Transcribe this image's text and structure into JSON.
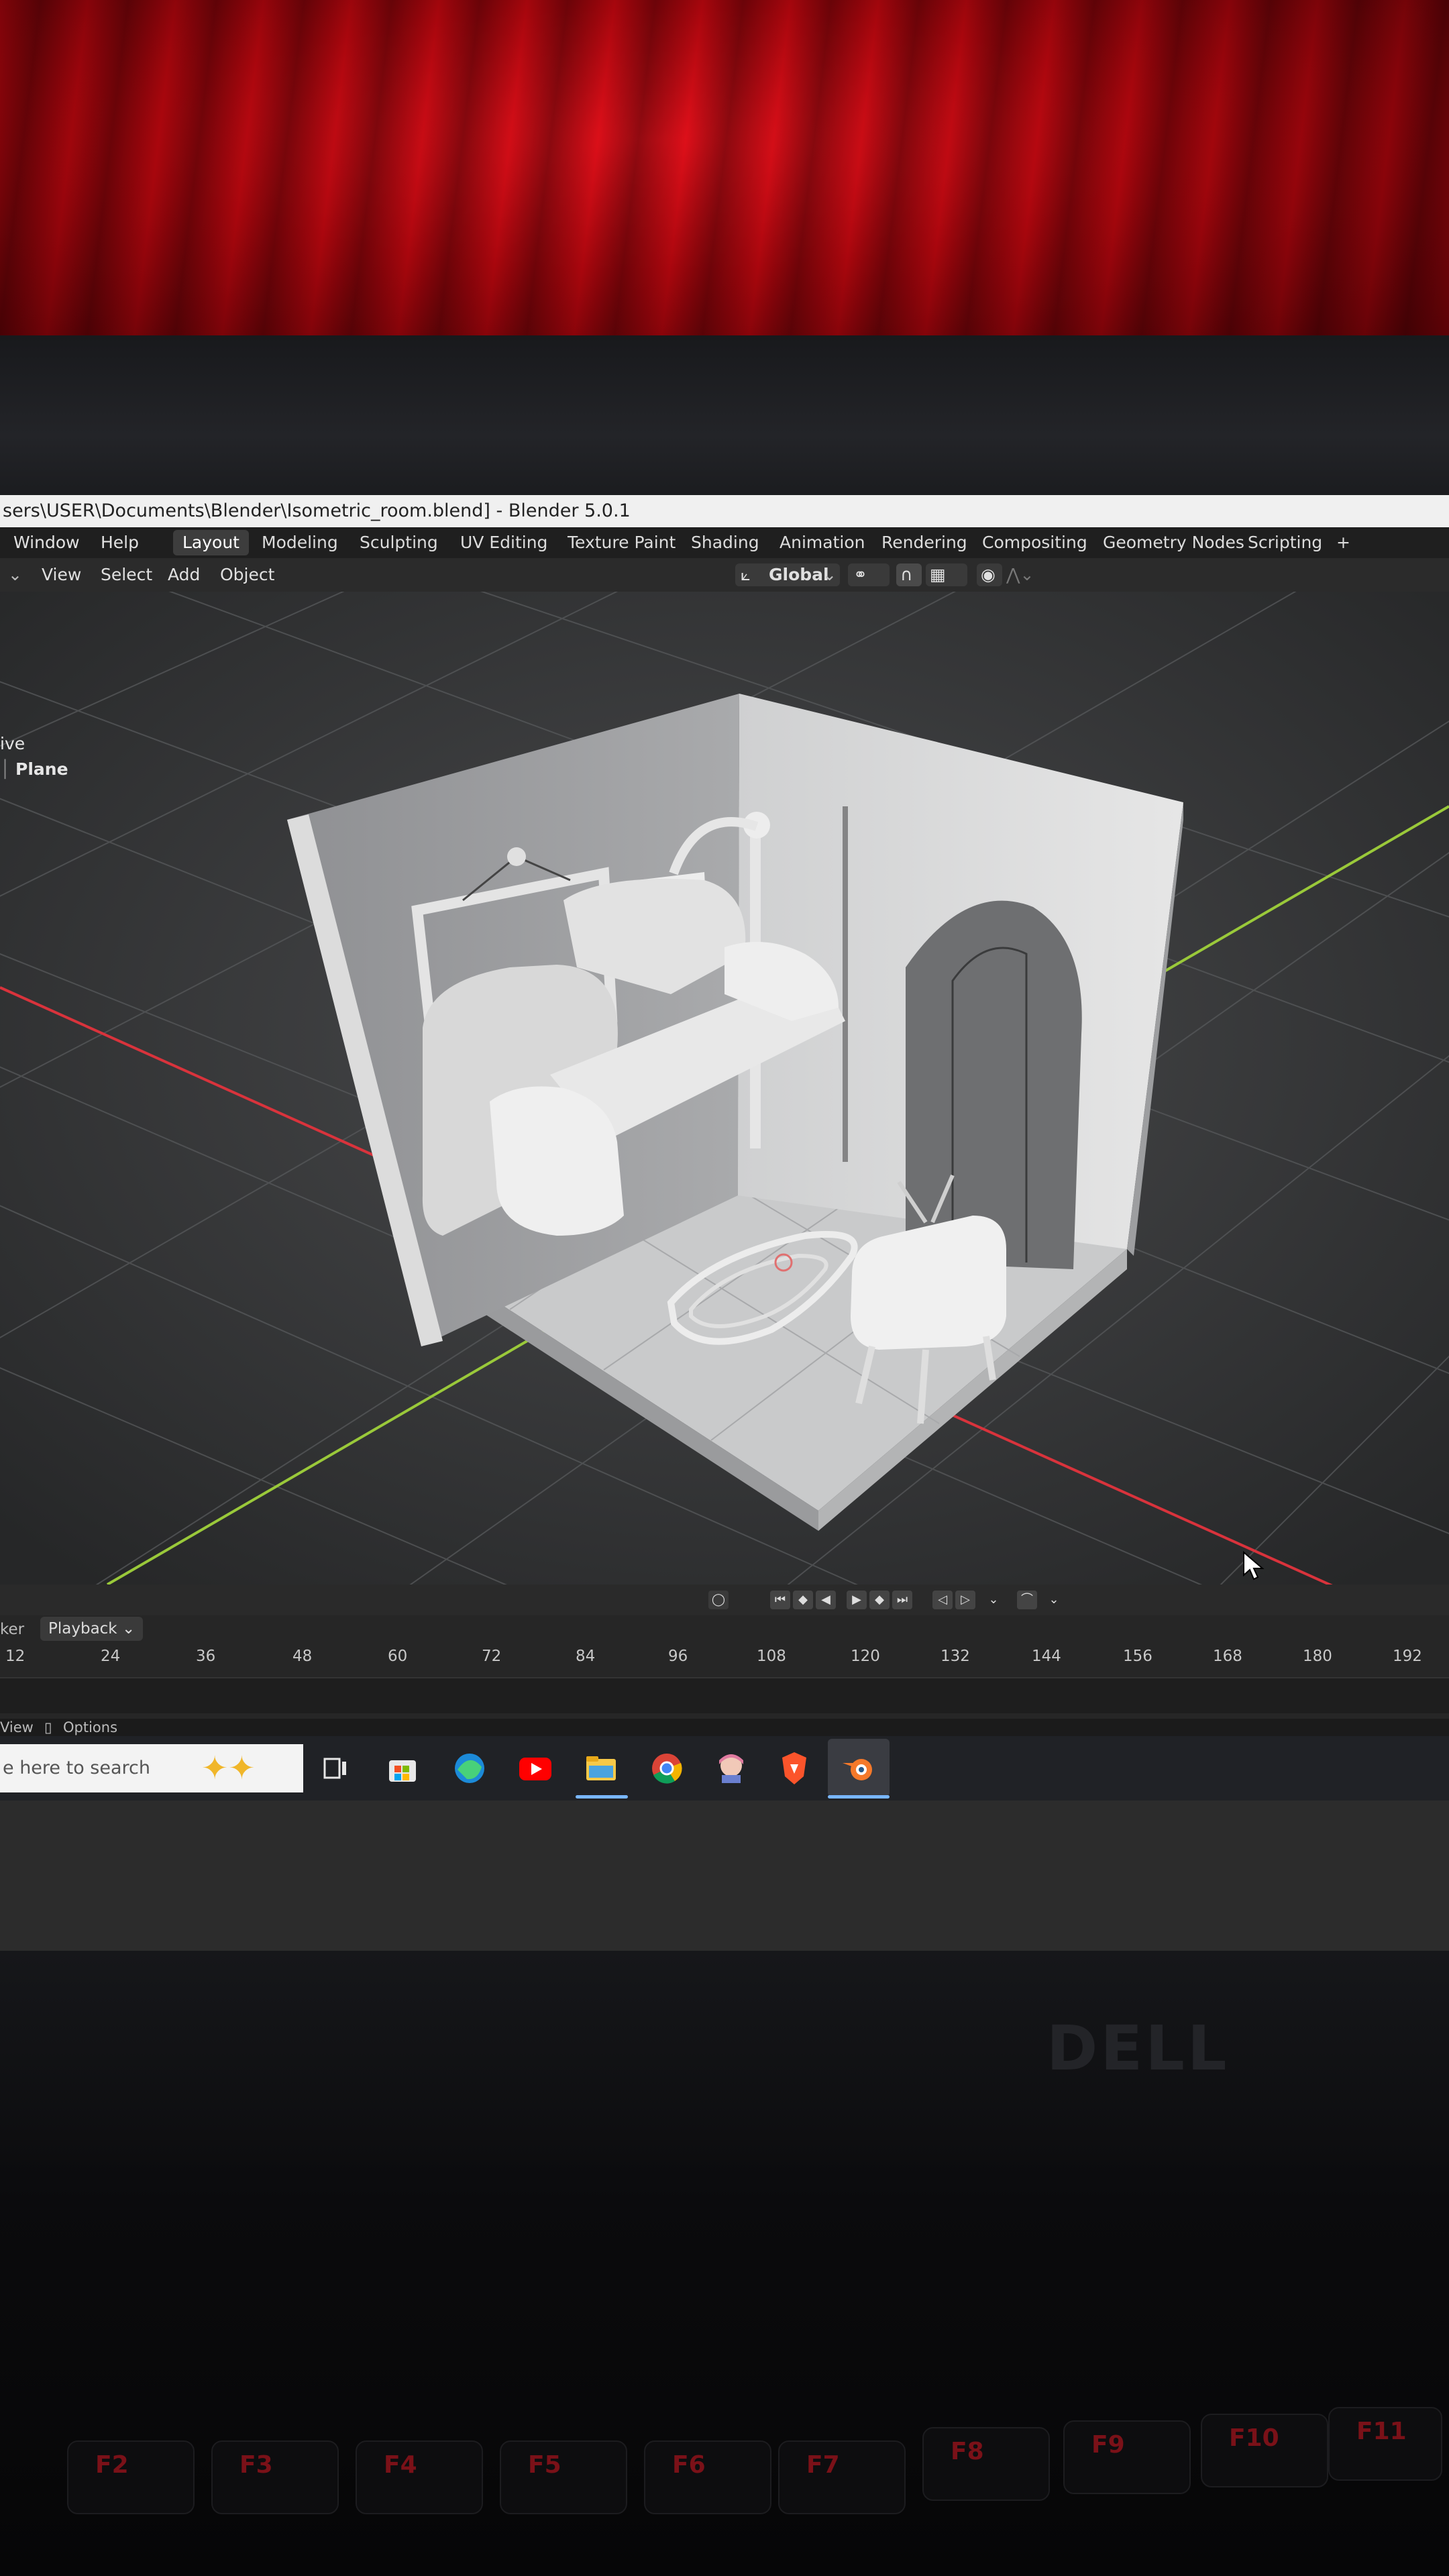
{
  "window": {
    "title": "sers\\USER\\Documents\\Blender\\Isometric_room.blend] - Blender 5.0.1"
  },
  "topbar": {
    "menus": [
      "Window",
      "Help"
    ],
    "workspaces": [
      "Layout",
      "Modeling",
      "Sculpting",
      "UV Editing",
      "Texture Paint",
      "Shading",
      "Animation",
      "Rendering",
      "Compositing",
      "Geometry Nodes",
      "Scripting",
      "+"
    ],
    "active_workspace": "Layout"
  },
  "viewport_header": {
    "menus": [
      "View",
      "Select",
      "Add",
      "Object"
    ],
    "orientation": "Global"
  },
  "outliner": {
    "collection_partial": "ive",
    "object": "Plane"
  },
  "timeline": {
    "marker_partial": "ker",
    "playback_label": "Playback",
    "ruler_ticks": [
      "12",
      "24",
      "36",
      "48",
      "60",
      "72",
      "84",
      "96",
      "108",
      "120",
      "132",
      "144",
      "156",
      "168",
      "180",
      "192"
    ]
  },
  "statusbar": {
    "view_label": "View",
    "options_label": "Options"
  },
  "taskbar": {
    "search_placeholder": "e here to search",
    "apps": [
      "task-view",
      "microsoft-store",
      "edge",
      "youtube",
      "file-explorer",
      "chrome",
      "anime-app",
      "brave",
      "blender"
    ]
  },
  "laptop": {
    "brand": "DELL",
    "fn_keys": [
      "F2",
      "F3",
      "F4",
      "F5",
      "F6",
      "F7",
      "F8",
      "F9",
      "F10",
      "F11"
    ]
  },
  "colors": {
    "blender_bg": "#2c2c2c",
    "header_bg": "#1f1f1f",
    "x_axis": "#d9333c",
    "y_axis": "#9ac93a",
    "active_tab": "#3d3d3d",
    "taskbar_accent": "#79b7ff"
  }
}
